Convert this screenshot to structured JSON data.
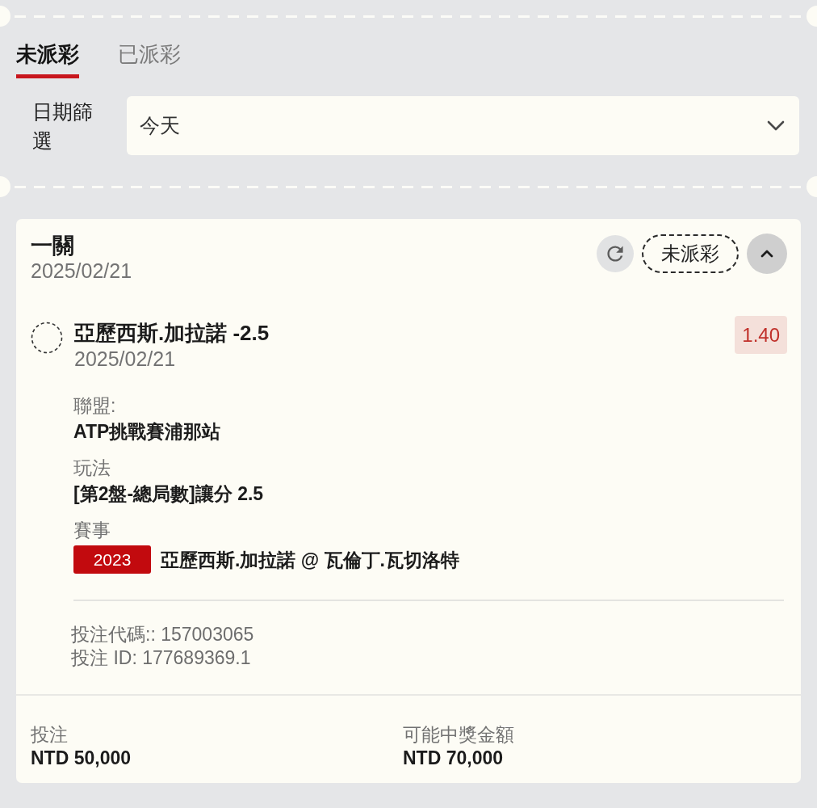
{
  "tabs": [
    {
      "label": "未派彩",
      "selected": true
    },
    {
      "label": "已派彩",
      "selected": false
    }
  ],
  "date_filter": {
    "label": "日期篩選",
    "value": "今天"
  },
  "bet_card": {
    "title": "一關",
    "date": "2025/02/21",
    "status": "未派彩",
    "expanded": true,
    "selection": {
      "title": "亞歷西斯.加拉諾 -2.5",
      "date": "2025/02/21",
      "odds": "1.40",
      "details": [
        {
          "label": "聯盟:",
          "value": "ATP挑戰賽浦那站"
        },
        {
          "label": "玩法",
          "value": "[第2盤-總局數]讓分 2.5"
        },
        {
          "label": "賽事",
          "tag": "2023",
          "value": "亞歷西斯.加拉諾 @ 瓦倫丁.瓦切洛特"
        }
      ]
    },
    "codes": [
      "投注代碼:: 157003065",
      "投注 ID: 177689369.1"
    ],
    "summary": [
      {
        "label": "投注",
        "value": "NTD 50,000"
      },
      {
        "label": "可能中獎金額",
        "value": "NTD 70,000"
      }
    ]
  }
}
